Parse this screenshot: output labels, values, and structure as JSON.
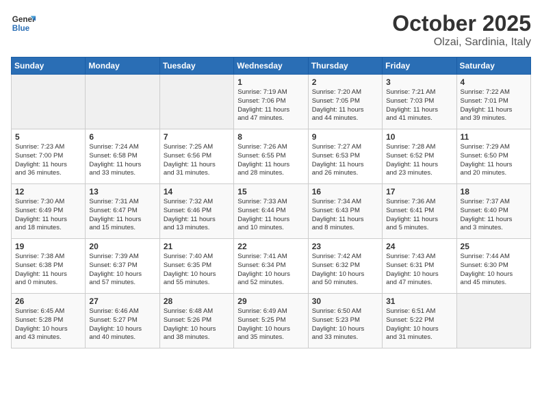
{
  "logo": {
    "line1": "General",
    "line2": "Blue"
  },
  "title": "October 2025",
  "subtitle": "Olzai, Sardinia, Italy",
  "days_of_week": [
    "Sunday",
    "Monday",
    "Tuesday",
    "Wednesday",
    "Thursday",
    "Friday",
    "Saturday"
  ],
  "weeks": [
    [
      {
        "day": "",
        "content": ""
      },
      {
        "day": "",
        "content": ""
      },
      {
        "day": "",
        "content": ""
      },
      {
        "day": "1",
        "content": "Sunrise: 7:19 AM\nSunset: 7:06 PM\nDaylight: 11 hours\nand 47 minutes."
      },
      {
        "day": "2",
        "content": "Sunrise: 7:20 AM\nSunset: 7:05 PM\nDaylight: 11 hours\nand 44 minutes."
      },
      {
        "day": "3",
        "content": "Sunrise: 7:21 AM\nSunset: 7:03 PM\nDaylight: 11 hours\nand 41 minutes."
      },
      {
        "day": "4",
        "content": "Sunrise: 7:22 AM\nSunset: 7:01 PM\nDaylight: 11 hours\nand 39 minutes."
      }
    ],
    [
      {
        "day": "5",
        "content": "Sunrise: 7:23 AM\nSunset: 7:00 PM\nDaylight: 11 hours\nand 36 minutes."
      },
      {
        "day": "6",
        "content": "Sunrise: 7:24 AM\nSunset: 6:58 PM\nDaylight: 11 hours\nand 33 minutes."
      },
      {
        "day": "7",
        "content": "Sunrise: 7:25 AM\nSunset: 6:56 PM\nDaylight: 11 hours\nand 31 minutes."
      },
      {
        "day": "8",
        "content": "Sunrise: 7:26 AM\nSunset: 6:55 PM\nDaylight: 11 hours\nand 28 minutes."
      },
      {
        "day": "9",
        "content": "Sunrise: 7:27 AM\nSunset: 6:53 PM\nDaylight: 11 hours\nand 26 minutes."
      },
      {
        "day": "10",
        "content": "Sunrise: 7:28 AM\nSunset: 6:52 PM\nDaylight: 11 hours\nand 23 minutes."
      },
      {
        "day": "11",
        "content": "Sunrise: 7:29 AM\nSunset: 6:50 PM\nDaylight: 11 hours\nand 20 minutes."
      }
    ],
    [
      {
        "day": "12",
        "content": "Sunrise: 7:30 AM\nSunset: 6:49 PM\nDaylight: 11 hours\nand 18 minutes."
      },
      {
        "day": "13",
        "content": "Sunrise: 7:31 AM\nSunset: 6:47 PM\nDaylight: 11 hours\nand 15 minutes."
      },
      {
        "day": "14",
        "content": "Sunrise: 7:32 AM\nSunset: 6:46 PM\nDaylight: 11 hours\nand 13 minutes."
      },
      {
        "day": "15",
        "content": "Sunrise: 7:33 AM\nSunset: 6:44 PM\nDaylight: 11 hours\nand 10 minutes."
      },
      {
        "day": "16",
        "content": "Sunrise: 7:34 AM\nSunset: 6:43 PM\nDaylight: 11 hours\nand 8 minutes."
      },
      {
        "day": "17",
        "content": "Sunrise: 7:36 AM\nSunset: 6:41 PM\nDaylight: 11 hours\nand 5 minutes."
      },
      {
        "day": "18",
        "content": "Sunrise: 7:37 AM\nSunset: 6:40 PM\nDaylight: 11 hours\nand 3 minutes."
      }
    ],
    [
      {
        "day": "19",
        "content": "Sunrise: 7:38 AM\nSunset: 6:38 PM\nDaylight: 11 hours\nand 0 minutes."
      },
      {
        "day": "20",
        "content": "Sunrise: 7:39 AM\nSunset: 6:37 PM\nDaylight: 10 hours\nand 57 minutes."
      },
      {
        "day": "21",
        "content": "Sunrise: 7:40 AM\nSunset: 6:35 PM\nDaylight: 10 hours\nand 55 minutes."
      },
      {
        "day": "22",
        "content": "Sunrise: 7:41 AM\nSunset: 6:34 PM\nDaylight: 10 hours\nand 52 minutes."
      },
      {
        "day": "23",
        "content": "Sunrise: 7:42 AM\nSunset: 6:32 PM\nDaylight: 10 hours\nand 50 minutes."
      },
      {
        "day": "24",
        "content": "Sunrise: 7:43 AM\nSunset: 6:31 PM\nDaylight: 10 hours\nand 47 minutes."
      },
      {
        "day": "25",
        "content": "Sunrise: 7:44 AM\nSunset: 6:30 PM\nDaylight: 10 hours\nand 45 minutes."
      }
    ],
    [
      {
        "day": "26",
        "content": "Sunrise: 6:45 AM\nSunset: 5:28 PM\nDaylight: 10 hours\nand 43 minutes."
      },
      {
        "day": "27",
        "content": "Sunrise: 6:46 AM\nSunset: 5:27 PM\nDaylight: 10 hours\nand 40 minutes."
      },
      {
        "day": "28",
        "content": "Sunrise: 6:48 AM\nSunset: 5:26 PM\nDaylight: 10 hours\nand 38 minutes."
      },
      {
        "day": "29",
        "content": "Sunrise: 6:49 AM\nSunset: 5:25 PM\nDaylight: 10 hours\nand 35 minutes."
      },
      {
        "day": "30",
        "content": "Sunrise: 6:50 AM\nSunset: 5:23 PM\nDaylight: 10 hours\nand 33 minutes."
      },
      {
        "day": "31",
        "content": "Sunrise: 6:51 AM\nSunset: 5:22 PM\nDaylight: 10 hours\nand 31 minutes."
      },
      {
        "day": "",
        "content": ""
      }
    ]
  ]
}
